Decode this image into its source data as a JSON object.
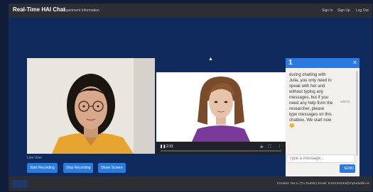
{
  "navbar": {
    "brand": "Real-Time HAI Chat",
    "experiment_info": "Experiment Information",
    "sign_in": "Sign In",
    "sign_up": "Sign Up",
    "log_out": "Log Out"
  },
  "video": {
    "time": "2:31",
    "play_icon": "pause-icon",
    "volume_icon": "volume-icon",
    "fullscreen_icon": "fullscreen-icon",
    "more_icon": "more-icon"
  },
  "chat": {
    "badge": "1",
    "close": "×",
    "message": "during chatting with Julia, you only need to speak with her and without typing any messages, but if you need any help from the researcher, please type messages on this chatbox. We start now 😊",
    "author": "admin",
    "input_placeholder": "Type a message...",
    "send_label": "SEND"
  },
  "user_label": "Live User",
  "buttons": {
    "start": "Start Recording",
    "stop": "Stop Recording",
    "share": "Share Screen"
  },
  "footer": {
    "contact": "Contact: Na Li (TU Dublin) Email: D18125334@mytudublin.ie"
  },
  "colors": {
    "accent": "#2a7ae0",
    "navbar": "#2b2f35",
    "content_bg": "#0f2a5c"
  }
}
